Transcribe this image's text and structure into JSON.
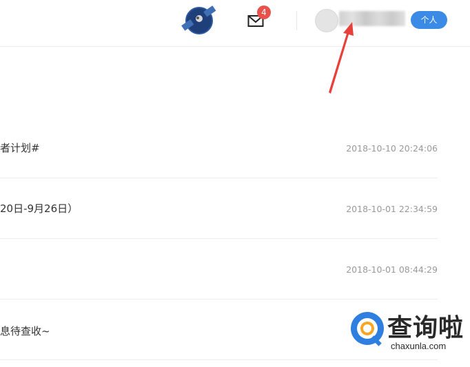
{
  "header": {
    "satellite_icon": "satellite-icon",
    "mail_icon": "mail-icon",
    "mail_badge": "4",
    "personal_label": "个人"
  },
  "list": {
    "rows": [
      {
        "title": "者计划#",
        "date": "2018-10-10 20:24:06"
      },
      {
        "title": "20日-9月26日）",
        "date": "2018-10-01 22:34:59"
      },
      {
        "title": "",
        "date": "2018-10-01 08:44:29"
      },
      {
        "title": "息待查收~",
        "date": ""
      }
    ]
  },
  "watermark": {
    "cn": "查询啦",
    "en": "chaxunla.com"
  },
  "colors": {
    "accent": "#3b8be6",
    "badge": "#e8524a",
    "arrow": "#e8413b",
    "text": "#333333",
    "muted": "#999999"
  }
}
